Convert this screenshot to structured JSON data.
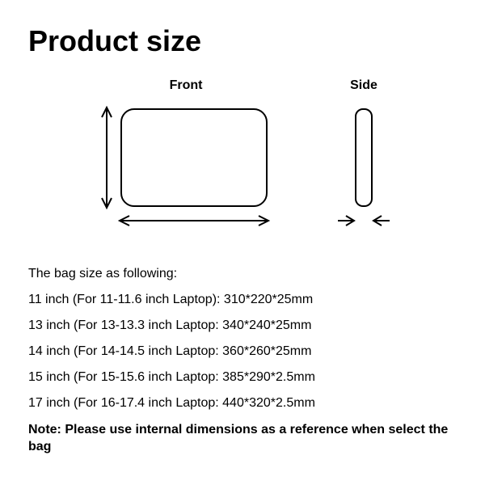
{
  "title": "Product size",
  "diagram": {
    "front_label": "Front",
    "side_label": "Side"
  },
  "sizes_heading": "The bag size as following:",
  "sizes": [
    "11 inch (For 11-11.6 inch Laptop): 310*220*25mm",
    "13 inch (For 13-13.3 inch Laptop: 340*240*25mm",
    "14 inch (For 14-14.5 inch Laptop: 360*260*25mm",
    "15 inch (For 15-15.6 inch Laptop: 385*290*2.5mm",
    "17 inch (For 16-17.4 inch Laptop: 440*320*2.5mm"
  ],
  "note": "Note: Please use internal dimensions as a reference when select the bag"
}
